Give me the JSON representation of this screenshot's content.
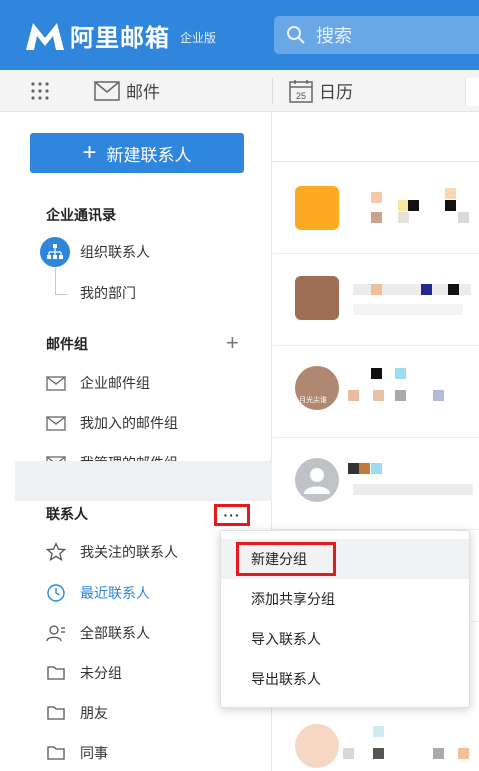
{
  "header": {
    "logo_text": "阿里邮箱",
    "edition": "企业版",
    "search_placeholder": "搜索"
  },
  "nav": {
    "mail_label": "邮件",
    "calendar_label": "日历",
    "calendar_day": "25"
  },
  "sidebar": {
    "new_contact_label": "新建联系人",
    "enterprise_section": "企业通讯录",
    "org_contacts": "组织联系人",
    "my_department": "我的部门",
    "mail_group_section": "邮件组",
    "mail_groups": [
      "企业邮件组",
      "我加入的邮件组",
      "我管理的邮件组"
    ],
    "contacts_section": "联系人",
    "more_label": "···",
    "contacts": [
      "我关注的联系人",
      "最近联系人",
      "全部联系人",
      "未分组",
      "朋友",
      "同事"
    ]
  },
  "popup_menu": {
    "items": [
      "新建分组",
      "添加共享分组",
      "导入联系人",
      "导出联系人"
    ]
  },
  "list": {
    "avatar_caption": "月光尖谁"
  },
  "colors": {
    "brand": "#2f86dc",
    "highlight": "#e31b1b"
  }
}
